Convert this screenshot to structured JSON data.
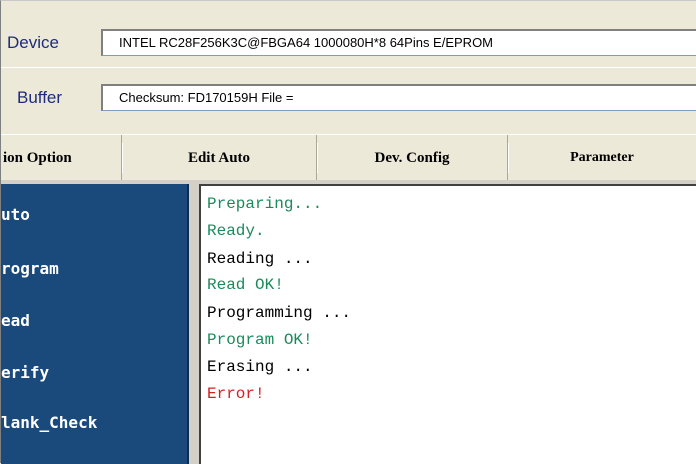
{
  "device": {
    "label": "Device",
    "value": "INTEL  RC28F256K3C@FBGA64  1000080H*8  64Pins  E/EPROM"
  },
  "buffer": {
    "label": "Buffer",
    "value": "Checksum: FD170159H   File ="
  },
  "tabs": [
    {
      "label": "ion Option"
    },
    {
      "label": "Edit Auto"
    },
    {
      "label": "Dev. Config"
    },
    {
      "label": "Parameter"
    }
  ],
  "sidebar": {
    "items": [
      {
        "label": "uto"
      },
      {
        "label": "rogram"
      },
      {
        "label": "ead"
      },
      {
        "label": "erify"
      },
      {
        "label": "lank_Check"
      }
    ]
  },
  "log": {
    "lines": [
      {
        "text": "Preparing...",
        "color": "#1a8a5a"
      },
      {
        "text": "Ready.",
        "color": "#1a8a5a"
      },
      {
        "text": "Reading ...",
        "color": "#000000"
      },
      {
        "text": "Read OK!",
        "color": "#1a8a5a"
      },
      {
        "text": "Programming ...",
        "color": "#000000"
      },
      {
        "text": "Program OK!",
        "color": "#1a8a5a"
      },
      {
        "text": "Erasing ...",
        "color": "#000000"
      },
      {
        "text": "Error!",
        "color": "#d42020"
      }
    ]
  }
}
